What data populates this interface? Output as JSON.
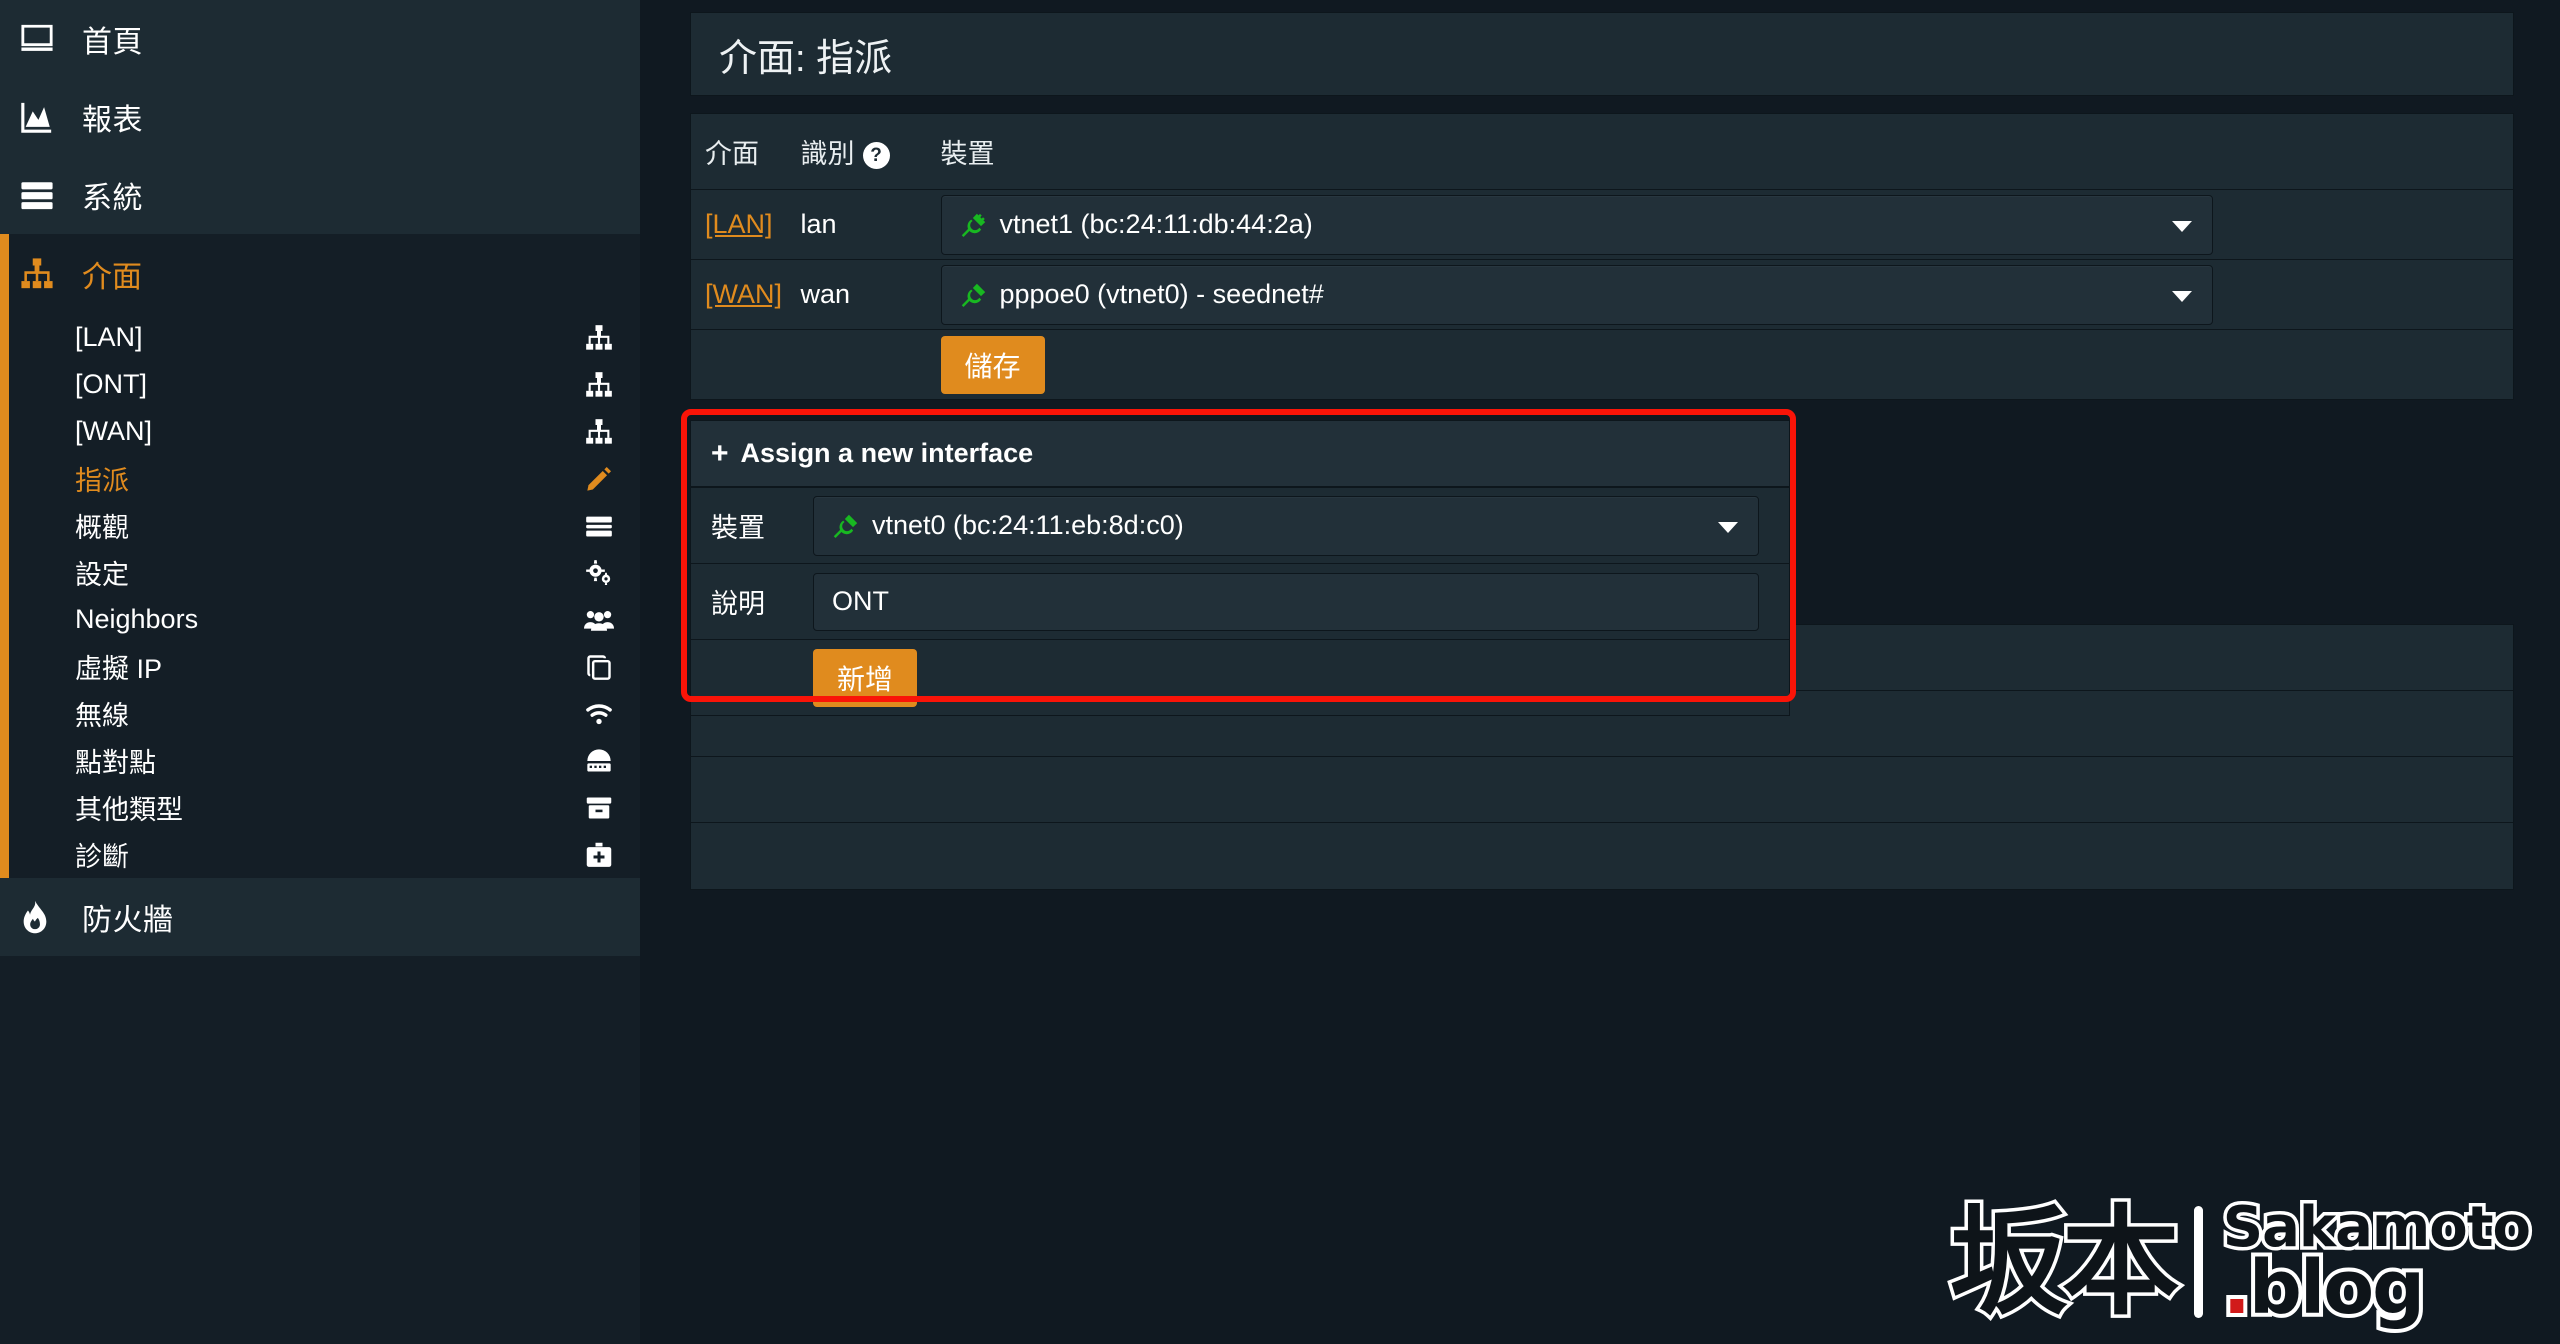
{
  "sidebar": {
    "top_items": [
      {
        "label": "首頁",
        "icon": "desktop-icon"
      },
      {
        "label": "報表",
        "icon": "chart-area-icon"
      },
      {
        "label": "系統",
        "icon": "server-icon"
      }
    ],
    "active_group": {
      "label": "介面",
      "icon": "sitemap-icon"
    },
    "sub_items": [
      {
        "label": "[LAN]",
        "icon": "sitemap-icon",
        "current": false
      },
      {
        "label": "[ONT]",
        "icon": "sitemap-icon",
        "current": false
      },
      {
        "label": "[WAN]",
        "icon": "sitemap-icon",
        "current": false
      },
      {
        "label": "指派",
        "icon": "pencil-icon",
        "current": true
      },
      {
        "label": "概觀",
        "icon": "server-icon",
        "current": false
      },
      {
        "label": "設定",
        "icon": "cogs-icon",
        "current": false
      },
      {
        "label": "Neighbors",
        "icon": "users-icon",
        "current": false
      },
      {
        "label": "虛擬 IP",
        "icon": "copy-icon",
        "current": false
      },
      {
        "label": "無線",
        "icon": "wifi-icon",
        "current": false
      },
      {
        "label": "點對點",
        "icon": "modem-icon",
        "current": false
      },
      {
        "label": "其他類型",
        "icon": "archive-icon",
        "current": false
      },
      {
        "label": "診斷",
        "icon": "medkit-icon",
        "current": false
      }
    ],
    "bottom_items": [
      {
        "label": "防火牆",
        "icon": "fire-icon"
      }
    ]
  },
  "page": {
    "title": "介面: 指派"
  },
  "assign_table": {
    "headers": {
      "interface": "介面",
      "identifier": "識別",
      "identifier_help": "?",
      "device": "裝置"
    },
    "rows": [
      {
        "interface": "[LAN]",
        "identifier": "lan",
        "device": "vtnet1 (bc:24:11:db:44:2a)"
      },
      {
        "interface": "[WAN]",
        "identifier": "wan",
        "device": "pppoe0 (vtnet0) - seednet#"
      }
    ],
    "save_label": "儲存"
  },
  "new_interface": {
    "heading": "Assign a new interface",
    "plus": "+",
    "device_label": "裝置",
    "device_value": "vtnet0 (bc:24:11:eb:8d:c0)",
    "description_label": "說明",
    "description_value": "ONT",
    "description_placeholder": "",
    "add_label": "新增"
  },
  "watermark": {
    "kanji": "坂本",
    "name": "Sakamoto",
    "blog_dot": ".",
    "blog": "blog"
  },
  "colors": {
    "accent": "#e08b1e",
    "panel": "#1d2b33",
    "page_bg": "#101921",
    "sidebar": "#141e26",
    "highlight_red": "#fa1408",
    "plug_green": "#18b821"
  }
}
